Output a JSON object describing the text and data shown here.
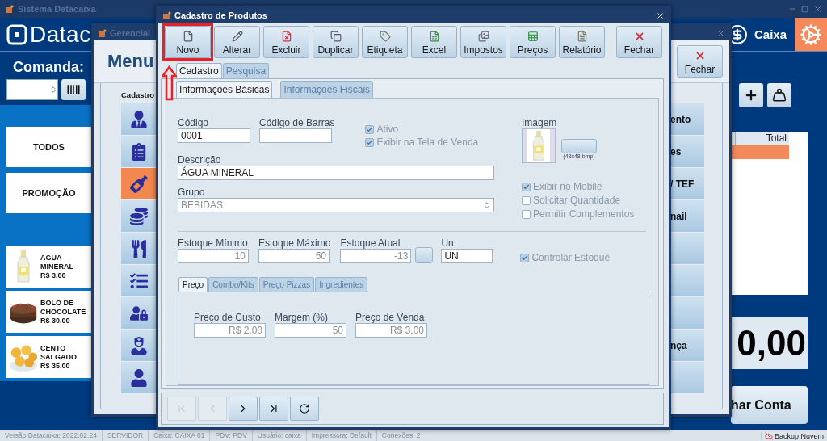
{
  "main_window": {
    "title": "Sistema Datacaixa",
    "logo": "Datac",
    "caixa_label": "Caixa",
    "comanda_label": "Comanda:",
    "categories": [
      {
        "label": "TODOS"
      },
      {
        "label": "PROMOÇÃO"
      }
    ],
    "products": [
      {
        "name": "ÁGUA MINERAL",
        "price": "R$ 3,00"
      },
      {
        "name": "BOLO DE CHOCOLATE",
        "price": "R$ 30,00"
      },
      {
        "name": "CENTO SALGADO",
        "price": "R$ 35,00"
      }
    ],
    "order_table": {
      "columns": [
        "Total"
      ],
      "rows": [
        {
          "selected": true
        }
      ]
    },
    "total": "0,00",
    "close_account_button": "har Conta"
  },
  "gerencial_window": {
    "title": "Gerencial",
    "heading": "Menu",
    "close_button": {
      "label": "Fechar"
    },
    "section_title": "Cadastro",
    "icon_buttons": [
      {
        "selected": false
      },
      {
        "selected": false
      },
      {
        "selected": true
      },
      {
        "selected": false
      },
      {
        "selected": false
      },
      {
        "selected": false
      },
      {
        "selected": false
      },
      {
        "selected": false
      },
      {
        "selected": false
      }
    ],
    "menu_buttons": [
      {
        "kind": "labeled",
        "label": "ento"
      },
      {
        "kind": "labeled",
        "label": "es"
      },
      {
        "kind": "labeled",
        "label": "/ TEF"
      },
      {
        "kind": "labeled",
        "label": "nail"
      },
      {
        "kind": "blank"
      },
      {
        "kind": "blank"
      },
      {
        "kind": "blank"
      },
      {
        "kind": "labeled",
        "label": "nça"
      },
      {
        "kind": "blank"
      }
    ]
  },
  "product_dialog": {
    "title": "Cadastro de Produtos",
    "toolbar": [
      {
        "label": "Novo",
        "kind": "action",
        "highlighted": true
      },
      {
        "label": "Alterar",
        "kind": "action",
        "highlighted": false
      },
      {
        "label": "Excluir",
        "kind": "action",
        "highlighted": false
      },
      {
        "label": "Duplicar",
        "kind": "action",
        "highlighted": false
      },
      {
        "label": "Etiqueta",
        "kind": "action",
        "highlighted": false
      },
      {
        "label": "Excel",
        "kind": "action",
        "highlighted": false
      },
      {
        "label": "Impostos",
        "kind": "action",
        "highlighted": false
      },
      {
        "label": "Preços",
        "kind": "action",
        "highlighted": false
      },
      {
        "label": "Relatório",
        "kind": "action",
        "highlighted": false
      },
      {
        "label": "Fechar",
        "kind": "close",
        "highlighted": false
      }
    ],
    "tabs": [
      {
        "label": "Cadastro",
        "selected": true
      },
      {
        "label": "Pesquisa",
        "selected": false
      }
    ],
    "subtabs": [
      {
        "label": "Informações Básicas",
        "selected": true
      },
      {
        "label": "Informações Fiscais",
        "selected": false
      }
    ],
    "form": {
      "code": {
        "label": "Código",
        "value": "0001",
        "disabled": false
      },
      "barcode": {
        "label": "Código de Barras"
      },
      "flags": [
        {
          "label": "Ativo",
          "checked": true
        },
        {
          "label": "Exibir na Tela de Venda",
          "checked": true
        }
      ],
      "description": {
        "label": "Descrição",
        "value": "ÁGUA MINERAL",
        "disabled": false
      },
      "group": {
        "label": "Grupo",
        "value": "BEBIDAS",
        "disabled": true
      },
      "image": {
        "label": "Imagem",
        "hint": "(48x48.bmp)"
      },
      "options": [
        {
          "label": "Exibir no Mobile",
          "checked": true
        },
        {
          "label": "Solicitar Quantidade",
          "checked": false
        },
        {
          "label": "Permitir Complementos",
          "checked": false
        }
      ],
      "stock": [
        {
          "label": "Estoque Mínimo",
          "value": "10",
          "disabled": true
        },
        {
          "label": "Estoque Máximo",
          "value": "50",
          "disabled": true
        },
        {
          "label": "Estoque Atual",
          "value": "-13",
          "disabled": true
        }
      ],
      "unit": {
        "label": "Un.",
        "value": "UN",
        "disabled": false
      },
      "stock_control": {
        "label": "Controlar Estoque",
        "checked": true
      }
    },
    "price_tabs": [
      {
        "label": "Preço",
        "selected": true
      },
      {
        "label": "Combo/Kits",
        "selected": false
      },
      {
        "label": "Preço Pizzas",
        "selected": false
      },
      {
        "label": "Ingredientes",
        "selected": false
      }
    ],
    "prices": [
      {
        "label": "Preço de Custo",
        "value": "R$ 2,00",
        "disabled": true
      },
      {
        "label": "Margem (%)",
        "value": "50",
        "disabled": true
      },
      {
        "label": "Preço de Venda",
        "value": "R$ 3,00",
        "disabled": true
      }
    ],
    "navigation": [
      {
        "disabled": true
      },
      {
        "disabled": true
      },
      {
        "disabled": false
      },
      {
        "disabled": false
      },
      {
        "disabled": false
      }
    ]
  },
  "status_bar": {
    "cells": [
      "Versão Datacaixa: 2022.02.24",
      "SERVIDOR",
      "Caixa: CAIXA 01",
      "PDV: PDV",
      "Usuário: caixa",
      "Impressora: Default",
      "Conexões: 2"
    ],
    "backup": "Backup Nuvem"
  }
}
